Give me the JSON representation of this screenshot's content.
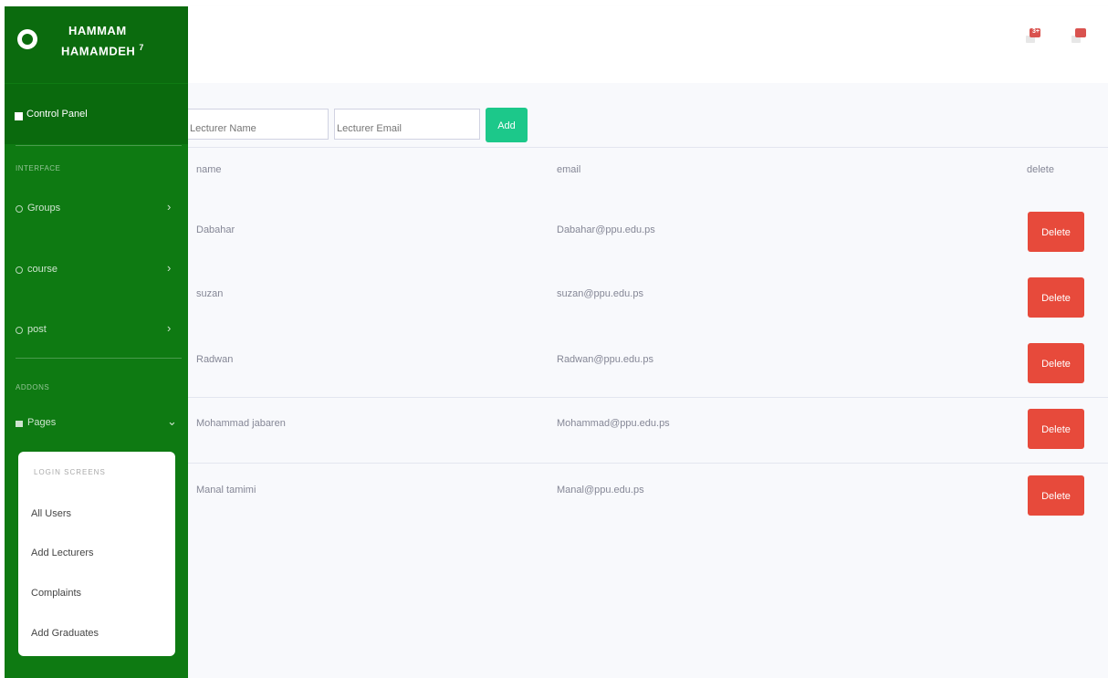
{
  "brand": {
    "name_line1": "HAMMAM",
    "name_line2": "HAMAMDEH",
    "superscript": "7"
  },
  "sidebar": {
    "dashboard_label": "Control Panel",
    "section1_heading": "INTERFACE",
    "section2_heading": "ADDONS",
    "items": [
      {
        "label": "Groups",
        "icon": "circle-icon",
        "chevron": "›"
      },
      {
        "label": "course",
        "icon": "circle-icon",
        "chevron": "›"
      },
      {
        "label": "post",
        "icon": "circle-icon",
        "chevron": "›"
      },
      {
        "label": "Pages",
        "icon": "folder-icon",
        "chevron": "⌄"
      }
    ],
    "submenu": {
      "heading": "LOGIN SCREENS",
      "items": [
        "All Users",
        "Add Lecturers",
        "Complaints",
        "Add Graduates"
      ]
    }
  },
  "topbar": {
    "alerts_badge": "3+",
    "messages_badge": ""
  },
  "form": {
    "name_placeholder": "Lecturer Name",
    "email_placeholder": "Lecturer Email",
    "add_label": "Add"
  },
  "table": {
    "headers": {
      "name": "name",
      "email": "email",
      "delete": "delete"
    },
    "delete_label": "Delete",
    "rows": [
      {
        "name": "Dabahar",
        "email": "Dabahar@ppu.edu.ps"
      },
      {
        "name": "suzan",
        "email": "suzan@ppu.edu.ps"
      },
      {
        "name": "Radwan",
        "email": "Radwan@ppu.edu.ps"
      },
      {
        "name": "Mohammad jabaren",
        "email": "Mohammad@ppu.edu.ps"
      },
      {
        "name": "Manal tamimi",
        "email": "Manal@ppu.edu.ps"
      }
    ]
  },
  "colors": {
    "sidebar": "#0e7a12",
    "add_button": "#1cc88a",
    "delete_button": "#e74a3b"
  }
}
